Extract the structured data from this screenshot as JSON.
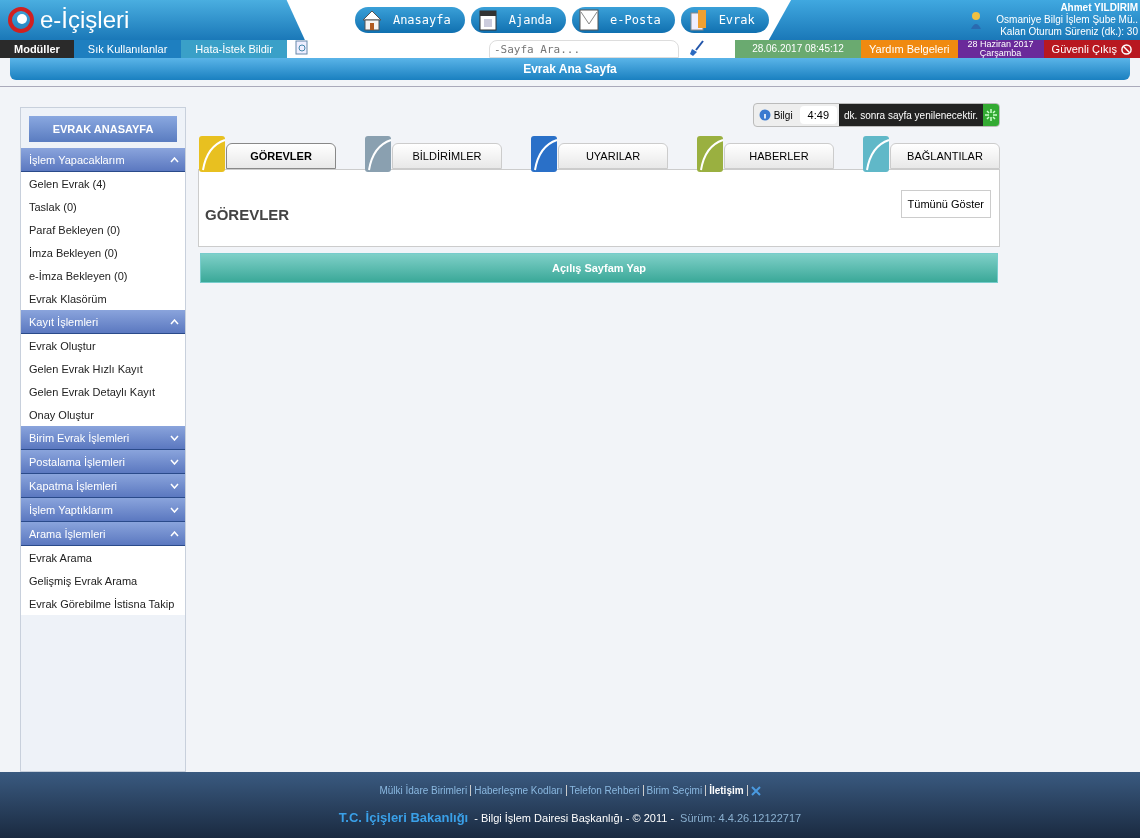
{
  "header": {
    "logo": "e-İçişleri",
    "nav": [
      {
        "kind": "home",
        "label": "Anasayfa"
      },
      {
        "kind": "calendar",
        "label": "Ajanda"
      },
      {
        "kind": "mail",
        "label": "e-Posta"
      },
      {
        "kind": "document",
        "label": "Evrak"
      }
    ],
    "user": {
      "name": "Ahmet YILDIRIM",
      "unit": "Osmaniye Bilgi İşlem Şube Mü..",
      "session": "Kalan Oturum Süreniz (dk.): 30"
    }
  },
  "menubar": {
    "items": [
      {
        "label": "Modüller",
        "color": "#2a2a2a"
      },
      {
        "label": "Sık Kullanılanlar",
        "color": "#1e7fc0"
      },
      {
        "label": "Hata-İstek Bildir",
        "color": "#3aa0c8"
      }
    ],
    "search": {
      "placeholder": "-Sayfa Ara..."
    },
    "datetime": "28.06.2017 08:45:12",
    "help": "Yardım Belgeleri",
    "date": "28 Haziran 2017",
    "weekday": "Çarşamba",
    "logout": "Güvenli Çıkış"
  },
  "page_title": "Evrak Ana Sayfa",
  "sidebar": {
    "title": "EVRAK ANASAYFA",
    "sections": [
      {
        "title": "İşlem Yapacaklarım",
        "expanded": true,
        "items": [
          "Gelen Evrak (4)",
          "Taslak (0)",
          "Paraf Bekleyen (0)",
          "İmza Bekleyen (0)",
          "e-İmza Bekleyen (0)",
          "Evrak Klasörüm"
        ]
      },
      {
        "title": "Kayıt İşlemleri",
        "expanded": true,
        "items": [
          "Evrak Oluştur",
          "Gelen Evrak Hızlı Kayıt",
          "Gelen Evrak Detaylı Kayıt",
          "Onay Oluştur"
        ]
      },
      {
        "title": "Birim Evrak İşlemleri",
        "expanded": false
      },
      {
        "title": "Postalama İşlemleri",
        "expanded": false
      },
      {
        "title": "Kapatma İşlemleri",
        "expanded": false
      },
      {
        "title": "İşlem Yaptıklarım",
        "expanded": false
      },
      {
        "title": "Arama İşlemleri",
        "expanded": true,
        "items": [
          "Evrak Arama",
          "Gelişmiş Evrak Arama",
          "Evrak Görebilme İstisna Takip"
        ]
      }
    ]
  },
  "refresh": {
    "info": "Bilgi",
    "countdown": "4:49",
    "message": "dk. sonra sayfa yenilenecektir."
  },
  "tabs": [
    {
      "label": "GÖREVLER",
      "selected": true,
      "color": "#e8c020"
    },
    {
      "label": "BİLDİRİMLER",
      "selected": false,
      "color": "#8aa0b0"
    },
    {
      "label": "UYARILAR",
      "selected": false,
      "color": "#2a70c8"
    },
    {
      "label": "HABERLER",
      "selected": false,
      "color": "#9ab040"
    },
    {
      "label": "BAĞLANTILAR",
      "selected": false,
      "color": "#60b8c8"
    }
  ],
  "panel": {
    "heading": "GÖREVLER",
    "show_all": "Tümünü Göster"
  },
  "homepage_button": "Açılış Sayfam Yap",
  "footer": {
    "links": [
      {
        "label": "Mülki İdare Birimleri",
        "bold": false
      },
      {
        "label": "Haberleşme Kodları",
        "bold": false
      },
      {
        "label": "Telefon Rehberi",
        "bold": false
      },
      {
        "label": "Birim Seçimi",
        "bold": false
      },
      {
        "label": "İletişim",
        "bold": true
      }
    ],
    "org": "T.C. İçişleri Bakanlığı",
    "dept": "- Bilgi İşlem Dairesi Başkanlığı - © 2011  -",
    "version": "Sürüm: 4.4.26.12122717"
  }
}
